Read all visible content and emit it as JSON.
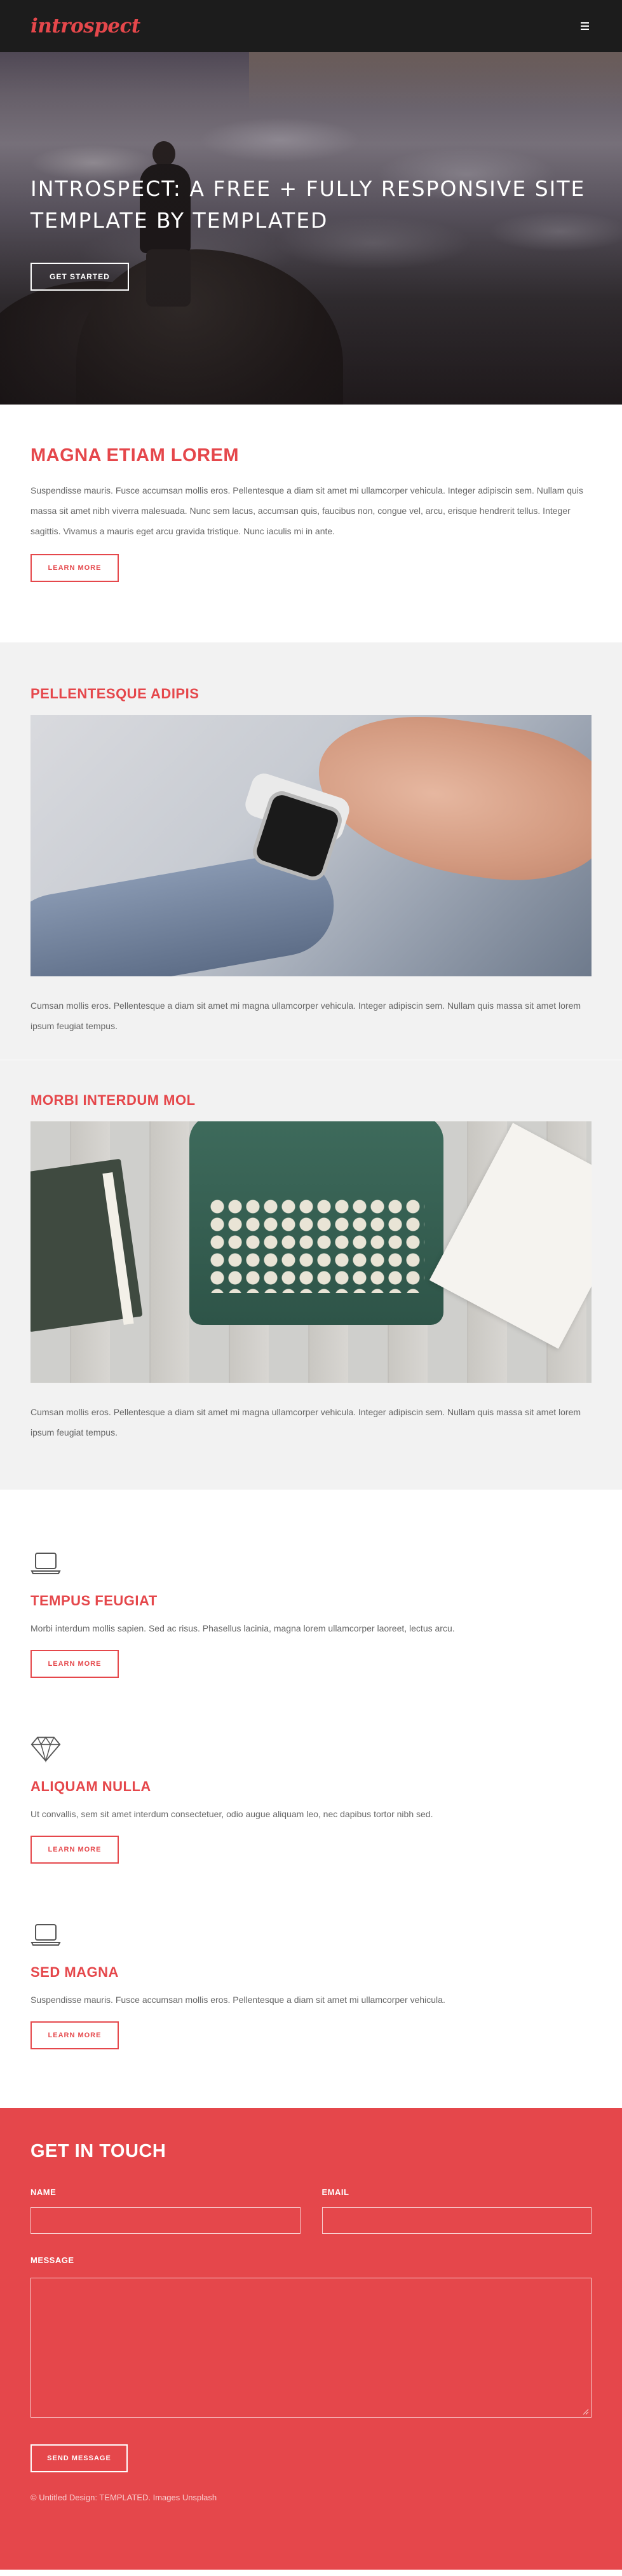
{
  "header": {
    "logo": "introspect",
    "menu_icon": "hamburger-menu-icon"
  },
  "banner": {
    "title": "INTROSPECT: A FREE + FULLY RESPONSIVE SITE TEMPLATE BY TEMPLATED",
    "button": "GET STARTED"
  },
  "intro": {
    "heading": "MAGNA ETIAM LOREM",
    "text": "Suspendisse mauris. Fusce accumsan mollis eros. Pellentesque a diam sit amet mi ullamcorper vehicula. Integer adipiscin sem. Nullam quis massa sit amet nibh viverra malesuada. Nunc sem lacus, accumsan quis, faucibus non, congue vel, arcu, erisque hendrerit tellus. Integer sagittis. Vivamus a mauris eget arcu gravida tristique. Nunc iaculis mi in ante.",
    "button": "LEARN MORE"
  },
  "feature1": {
    "heading": "PELLENTESQUE ADIPIS",
    "text": "Cumsan mollis eros. Pellentesque a diam sit amet mi magna ullamcorper vehicula. Integer adipiscin sem. Nullam quis massa sit amet lorem ipsum feugiat tempus."
  },
  "feature2": {
    "heading": "MORBI INTERDUM MOL",
    "text": "Cumsan mollis eros. Pellentesque a diam sit amet mi magna ullamcorper vehicula. Integer adipiscin sem. Nullam quis massa sit amet lorem ipsum feugiat tempus."
  },
  "services": [
    {
      "icon": "laptop-icon",
      "heading": "TEMPUS FEUGIAT",
      "text": "Morbi interdum mollis sapien. Sed ac risus. Phasellus lacinia, magna lorem ullamcorper laoreet, lectus arcu.",
      "button": "LEARN MORE"
    },
    {
      "icon": "diamond-icon",
      "heading": "ALIQUAM NULLA",
      "text": "Ut convallis, sem sit amet interdum consectetuer, odio augue aliquam leo, nec dapibus tortor nibh sed.",
      "button": "LEARN MORE"
    },
    {
      "icon": "laptop-icon",
      "heading": "SED MAGNA",
      "text": "Suspendisse mauris. Fusce accumsan mollis eros. Pellentesque a diam sit amet mi ullamcorper vehicula.",
      "button": "LEARN MORE"
    }
  ],
  "contact": {
    "heading": "GET IN TOUCH",
    "name_label": "NAME",
    "email_label": "EMAIL",
    "message_label": "MESSAGE",
    "name_value": "",
    "email_value": "",
    "message_value": "",
    "button": "SEND MESSAGE",
    "copyright": "© Untitled Design: TEMPLATED. Images Unsplash"
  },
  "colors": {
    "accent": "#e5474b",
    "header_bg": "#1c1c1c",
    "grey_bg": "#f2f2f2"
  }
}
